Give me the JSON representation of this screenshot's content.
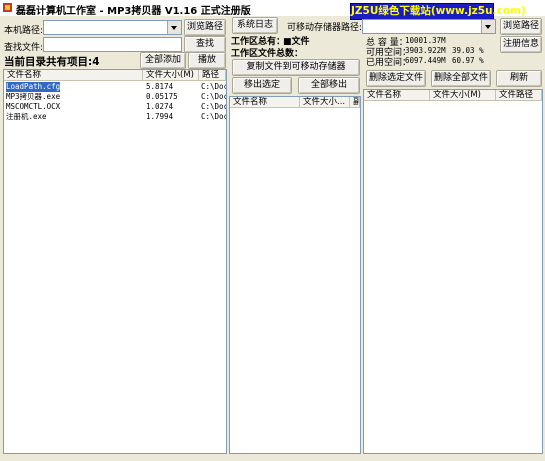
{
  "window": {
    "title": "磊磊计算机工作室 - MP3拷贝器 V1.16  正式注册版",
    "brand_text": "JZ5U绿色下载站(www.jz5u.com)",
    "bg_color": "#ece9d8",
    "brand_bg": "#1c1cc4",
    "brand_fg": "#ffff00"
  },
  "left": {
    "local_path_label": "本机路径:",
    "local_path_value": "",
    "browse_button": "浏览路径",
    "find_file_label": "查找文件:",
    "find_file_value": "",
    "search_button": "查找",
    "item_count_text": "当前目录共有项目:4",
    "add_all_button": "全部添加",
    "play_button": "播放",
    "columns": [
      "文件名称",
      "文件大小(M)",
      "路径"
    ],
    "rows": [
      {
        "name": "LoadPath.cfg",
        "size": "5.8174",
        "path": "C:\\Doc",
        "selected": true
      },
      {
        "name": "MP3拷贝器.exe",
        "size": "0.05175",
        "path": "C:\\Doc",
        "selected": false
      },
      {
        "name": "MSCOMCTL.OCX",
        "size": "1.0274",
        "path": "C:\\Doc",
        "selected": false
      },
      {
        "name": "注册机.exe",
        "size": "1.7994",
        "path": "C:\\Doc",
        "selected": false
      }
    ]
  },
  "middle": {
    "system_log_button": "系统日志",
    "workspace_total_label": "工作区总有：",
    "workspace_total_value": "■文件",
    "workspace_size_label": "工作区文件总数：",
    "copy_button": "复制文件到可移动存储器",
    "move_out_selected_button": "移出选定",
    "move_out_all_button": "全部移出",
    "columns": [
      "文件名称",
      "文件大小...",
      "副"
    ]
  },
  "right": {
    "removable_path_label": "可移动存储器路径:",
    "removable_path_value": "",
    "browse_button": "浏览路径",
    "register_info_button": "注册信息",
    "total_capacity_label": "总 容 量：",
    "total_capacity_value": "10001.37M",
    "free_space_label": "可用空间：",
    "free_space_value": "3903.922M",
    "free_space_pct": "39.03 %",
    "used_space_label": "已用空间：",
    "used_space_value": "6097.449M",
    "used_space_pct": "60.97 %",
    "delete_selected_button": "删除选定文件",
    "delete_all_button": "删除全部文件",
    "refresh_button": "刷新",
    "columns": [
      "文件名称",
      "文件大小(M)",
      "文件路径"
    ]
  }
}
